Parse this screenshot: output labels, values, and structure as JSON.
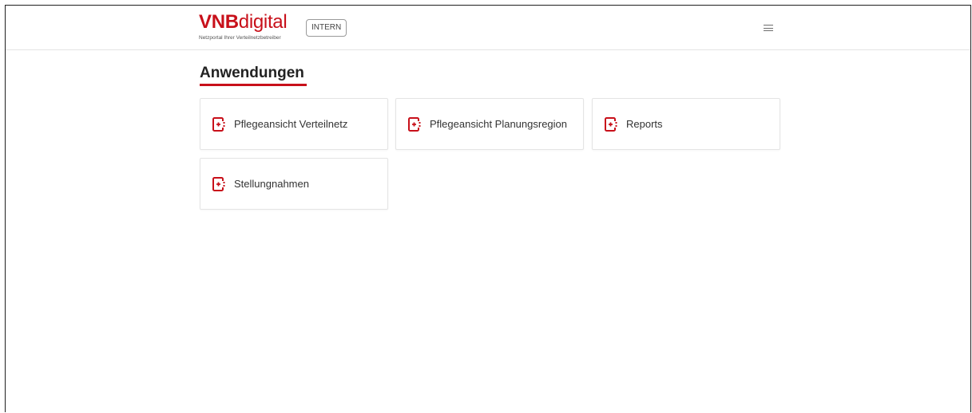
{
  "header": {
    "logo_bold": "VNB",
    "logo_light": "digital",
    "logo_subtitle": "Netzportal Ihrer Verteilnetzbetreiber",
    "badge": "INTERN",
    "menu_icon": "hamburger-menu-icon"
  },
  "main": {
    "title": "Anwendungen",
    "tiles": [
      {
        "label": "Pflegeansicht Verteilnetz",
        "icon": "app-launch-icon"
      },
      {
        "label": "Pflegeansicht Planungsregion",
        "icon": "app-launch-icon"
      },
      {
        "label": "Reports",
        "icon": "app-launch-icon"
      },
      {
        "label": "Stellungnahmen",
        "icon": "app-launch-icon"
      }
    ]
  },
  "colors": {
    "brand_red": "#c8101a",
    "text": "#333333",
    "border": "#e4e4e4"
  }
}
